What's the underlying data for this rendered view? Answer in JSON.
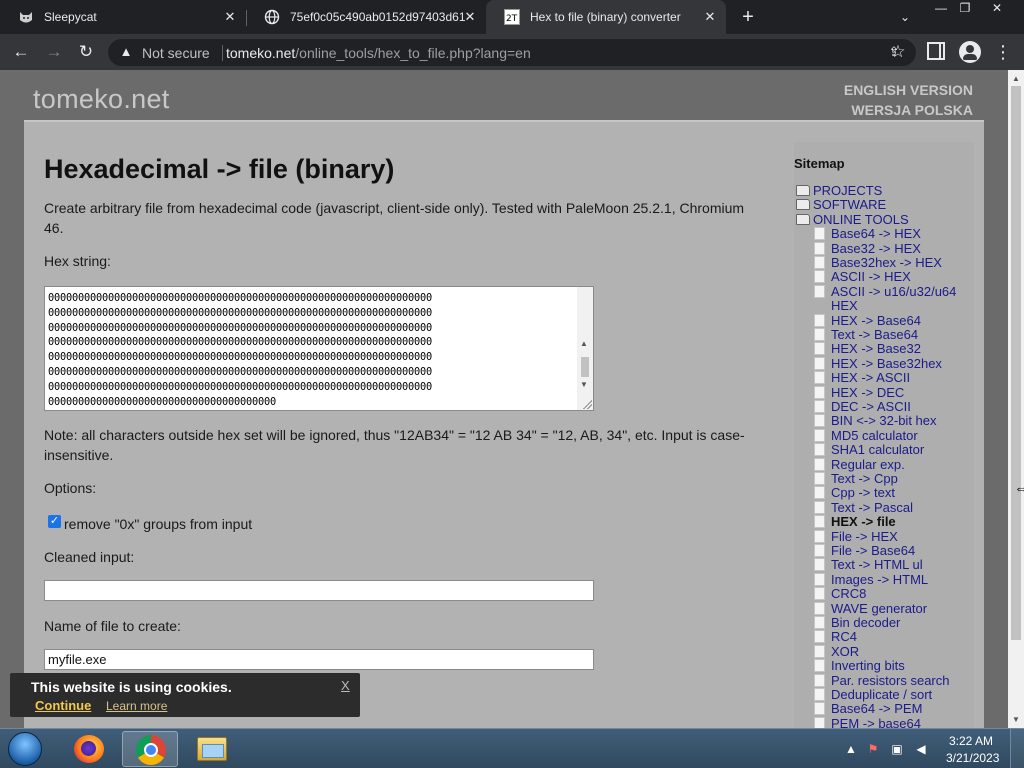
{
  "browser": {
    "tabs": [
      {
        "title": "Sleepycat",
        "icon": "cat-favicon-icon",
        "active": false
      },
      {
        "title": "75ef0c05c490ab0152d97403d612",
        "icon": "globe-icon",
        "active": false
      },
      {
        "title": "Hex to file (binary) converter",
        "icon": "site-favicon-icon",
        "active": true
      }
    ],
    "security_label": "Not secure",
    "url_host": "tomeko.net",
    "url_path": "/online_tools/hex_to_file.php?lang=en"
  },
  "site": {
    "logo": "tomeko.net",
    "lang_links": [
      "ENGLISH VERSION",
      "WERSJA POLSKA"
    ]
  },
  "main": {
    "title": "Hexadecimal -> file (binary)",
    "intro_line1": "Create arbitrary file from hexadecimal code (javascript, client-side only). Tested with PaleMoon 25.2.1, Chromium",
    "intro_line2": "46.",
    "hex_label": "Hex string:",
    "hex_value": "0000000000000000000000000000000000000000000000000000000000000000\n0000000000000000000000000000000000000000000000000000000000000000\n0000000000000000000000000000000000000000000000000000000000000000\n0000000000000000000000000000000000000000000000000000000000000000\n0000000000000000000000000000000000000000000000000000000000000000\n0000000000000000000000000000000000000000000000000000000000000000\n0000000000000000000000000000000000000000000000000000000000000000\n00000000000000000000000000000000000000",
    "note_line1": "Note: all characters outside hex set will be ignored, thus \"12AB34\" = \"12 AB 34\" = \"12, AB, 34\", etc. Input is case-",
    "note_line2": "insensitive.",
    "options_label": "Options:",
    "remove_0x_label": "remove \"0x\" groups from input",
    "remove_0x_checked": true,
    "cleaned_label": "Cleaned input:",
    "cleaned_value": "",
    "filename_label": "Name of file to create:",
    "filename_value": "myfile.exe"
  },
  "sidebar": {
    "title": "Sitemap",
    "folders": [
      "PROJECTS",
      "SOFTWARE",
      "ONLINE TOOLS"
    ],
    "tools": [
      "Base64 -> HEX",
      "Base32 -> HEX",
      "Base32hex -> HEX",
      "ASCII -> HEX",
      "ASCII -> u16/u32/u64",
      "HEX",
      "HEX -> Base64",
      "Text -> Base64",
      "HEX -> Base32",
      "HEX -> Base32hex",
      "HEX -> ASCII",
      "HEX -> DEC",
      "DEC -> ASCII",
      "BIN <-> 32-bit hex",
      "MD5 calculator",
      "SHA1 calculator",
      "Regular exp.",
      "Text -> Cpp",
      "Cpp -> text",
      "Text -> Pascal",
      "HEX -> file",
      "File -> HEX",
      "File -> Base64",
      "Text -> HTML ul",
      "Images -> HTML",
      "CRC8",
      "WAVE generator",
      "Bin decoder",
      "RC4",
      "XOR",
      "Inverting bits",
      "Par. resistors search",
      "Deduplicate / sort",
      "Base64 -> PEM",
      "PEM -> base64"
    ],
    "current_tool": "HEX -> file"
  },
  "cookie_banner": {
    "message": "This website is using cookies.",
    "continue": "Continue",
    "learn_more": "Learn more",
    "close": "X"
  },
  "taskbar": {
    "apps": [
      "start-button",
      "firefox",
      "chrome",
      "file-explorer"
    ],
    "time": "3:22 AM",
    "date": "3/21/2023"
  }
}
